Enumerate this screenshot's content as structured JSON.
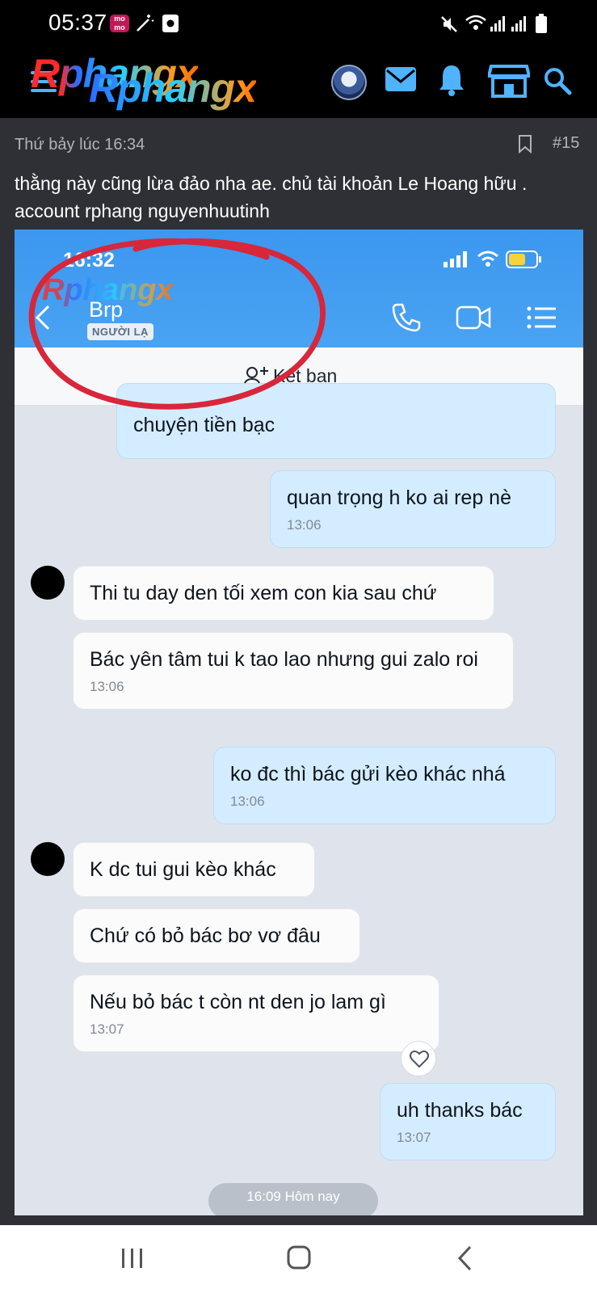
{
  "status_bar": {
    "time": "05:37",
    "momo": "mo mo"
  },
  "header": {
    "logo": "Rphangx",
    "logo_overlay": "Rphangx"
  },
  "post": {
    "meta": "Thứ bảy lúc 16:34",
    "number": "#15",
    "text": "thằng này cũng lừa đảo nha ae. chủ tài khoản Le Hoang hữu . account rphang nguyenhuutinh"
  },
  "chat": {
    "time": "16:32",
    "contact_name": "Brp",
    "contact_tag": "NGƯỜI LẠ",
    "watermark": "Rphangx",
    "add_friend": "Kết bạn",
    "messages": [
      {
        "dir": "out",
        "text": "chuyện tiền bạc",
        "time": ""
      },
      {
        "dir": "out",
        "text": "quan trọng h ko ai rep nè",
        "time": "13:06"
      },
      {
        "dir": "in",
        "text": "Thi tu day den tối xem con kia sau chứ",
        "time": ""
      },
      {
        "dir": "in",
        "text": "Bác yên tâm tui k tao lao nhưng gui zalo roi",
        "time": "13:06"
      },
      {
        "dir": "out",
        "text": "ko đc thì bác gửi kèo khác nhá",
        "time": "13:06"
      },
      {
        "dir": "in",
        "text": "K dc tui gui kèo khác",
        "time": ""
      },
      {
        "dir": "in",
        "text": "Chứ có bỏ bác bơ vơ đâu",
        "time": ""
      },
      {
        "dir": "in",
        "text": "Nếu bỏ bác t còn nt den jo lam gì",
        "time": "13:07"
      },
      {
        "dir": "out",
        "text": "uh thanks bác",
        "time": "13:07"
      }
    ],
    "date_separator": "16:09 Hôm nay"
  },
  "colors": {
    "zalo_blue": "#3b97f0",
    "outgoing_bubble": "#d4ecff",
    "accent_icon": "#4fb3ff",
    "circle_mark": "#d8263a"
  }
}
